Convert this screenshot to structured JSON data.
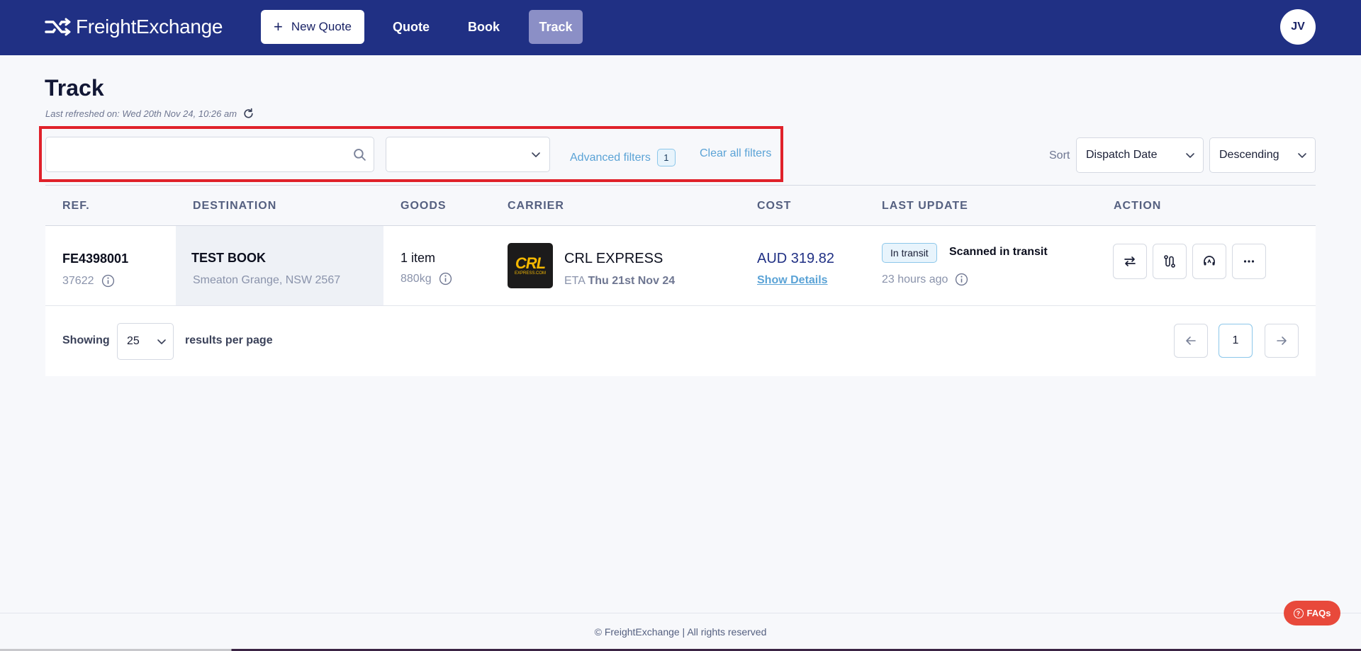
{
  "header": {
    "brand": "FreightExchange",
    "new_quote_label": "New Quote",
    "nav": {
      "quote": "Quote",
      "book": "Book",
      "track": "Track"
    },
    "avatar_initials": "JV"
  },
  "page": {
    "title": "Track",
    "last_refreshed": "Last refreshed on: Wed 20th Nov 24, 10:26 am"
  },
  "filters": {
    "search_value": "",
    "status_value": "",
    "advanced_label": "Advanced filters",
    "advanced_count": "1",
    "clear_label": "Clear all filters"
  },
  "sort": {
    "label": "Sort",
    "field": "Dispatch Date",
    "order": "Descending"
  },
  "table": {
    "columns": {
      "ref": "REF.",
      "destination": "DESTINATION",
      "goods": "GOODS",
      "carrier": "CARRIER",
      "cost": "COST",
      "last_update": "LAST UPDATE",
      "action": "ACTION"
    },
    "rows": [
      {
        "ref": "FE4398001",
        "ref_sub": "37622",
        "destination": "TEST BOOK",
        "destination_sub": "Smeaton Grange, NSW 2567",
        "goods": "1 item",
        "goods_sub": "880kg",
        "carrier_logo_text": "CRL",
        "carrier_logo_sub": "EXPRESS.COM",
        "carrier": "CRL EXPRESS",
        "eta_label": "ETA",
        "eta_value": "Thu 21st Nov 24",
        "cost": "AUD 319.82",
        "cost_link": "Show Details",
        "status": "In transit",
        "status_text": "Scanned in transit",
        "updated": "23 hours ago"
      }
    ]
  },
  "pagination": {
    "showing_label": "Showing",
    "per_page": "25",
    "per_page_label": "results per page",
    "current_page": "1"
  },
  "footer": {
    "text": "© FreightExchange | All rights reserved",
    "faq_label": "FAQs"
  },
  "colors": {
    "header_bg": "#203084",
    "active_nav": "#8b8fc6",
    "link": "#5ba3d6",
    "highlight": "#e0212a",
    "faq": "#e8493b"
  },
  "icons": {
    "search": "search-icon",
    "chevron": "chevron-down-icon",
    "refresh": "refresh-icon",
    "info": "info-icon",
    "swap": "swap-icon",
    "route": "route-icon",
    "support": "headset-icon",
    "more": "more-icon",
    "prev": "arrow-left-icon",
    "next": "arrow-right-icon"
  }
}
